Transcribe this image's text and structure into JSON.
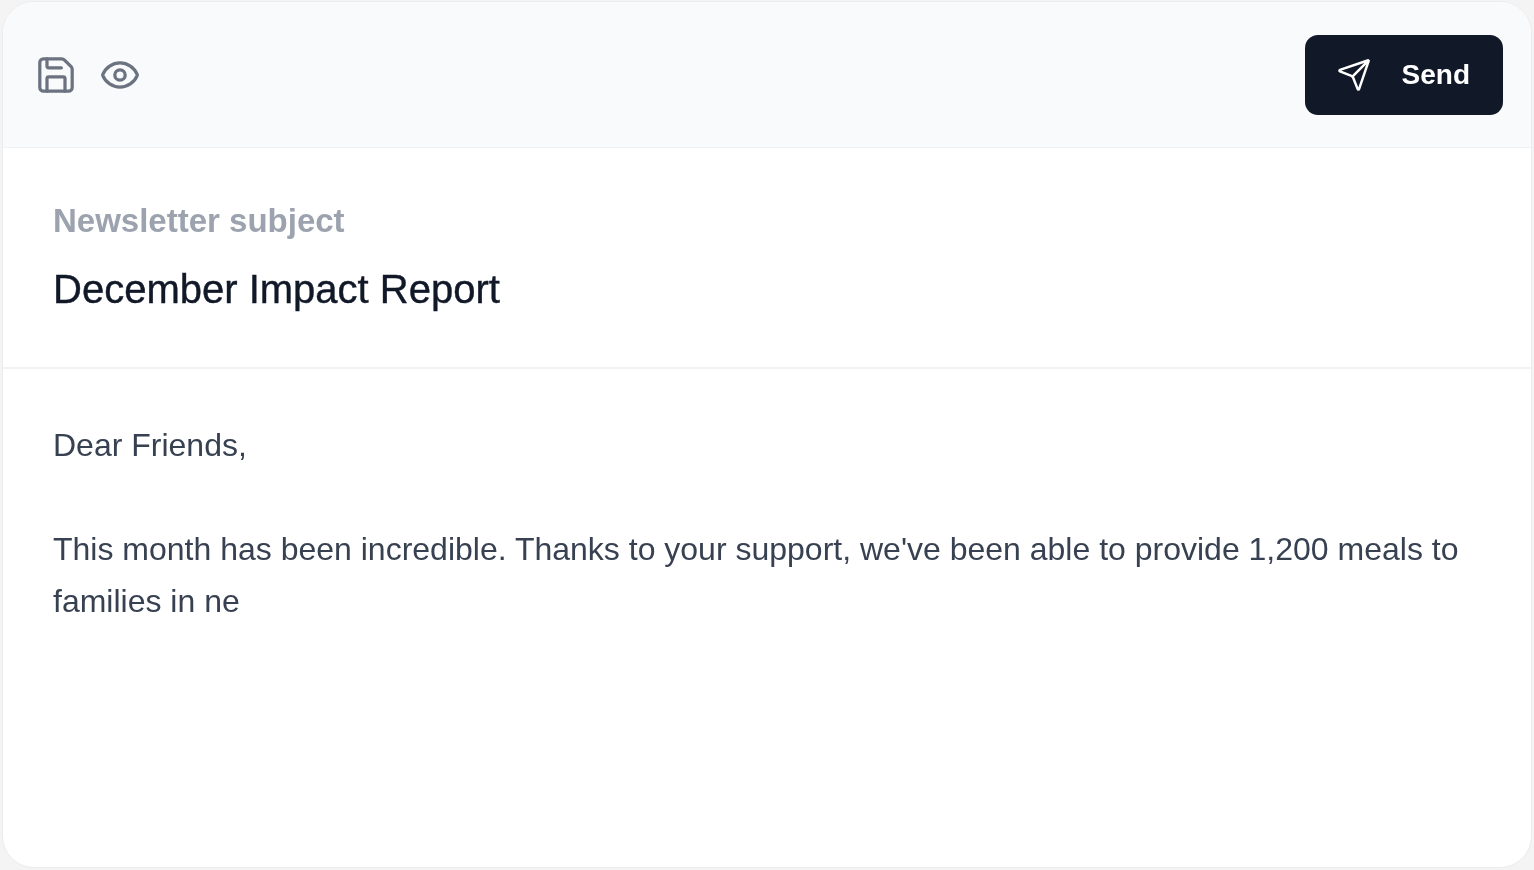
{
  "toolbar": {
    "send_button": {
      "label": "Send"
    }
  },
  "subject": {
    "label": "Newsletter subject",
    "value": "December Impact Report"
  },
  "body": {
    "value": "Dear Friends,\n\nThis month has been incredible. Thanks to your support, we've been able to provide 1,200 meals to families in ne"
  }
}
